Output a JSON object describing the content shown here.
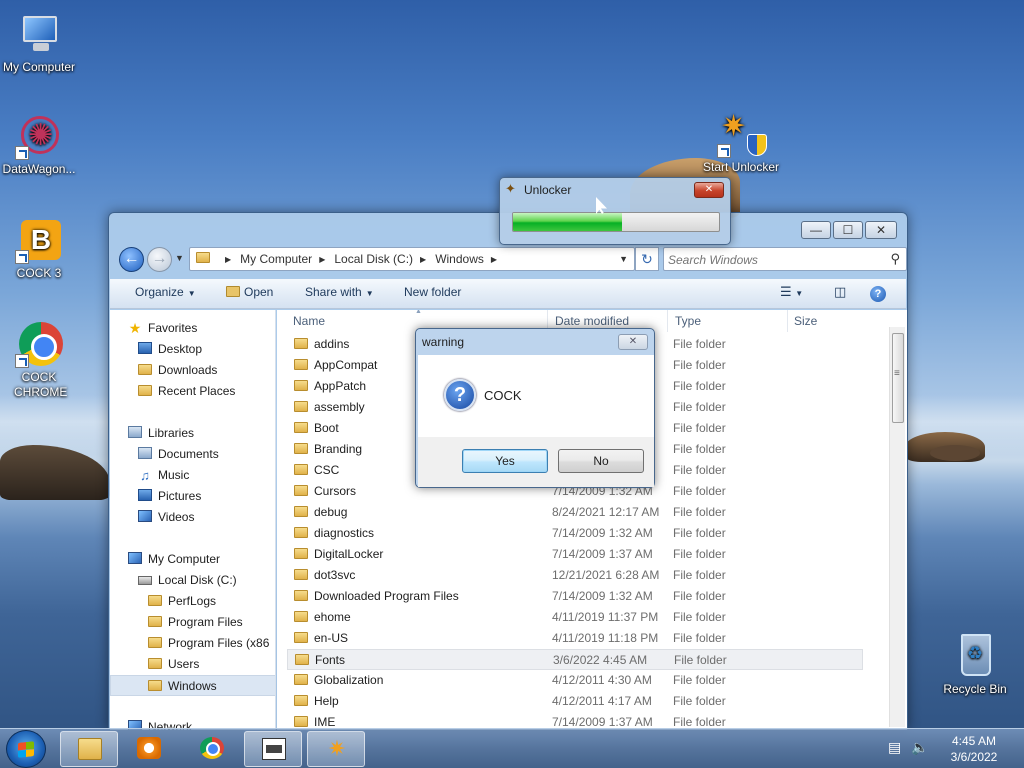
{
  "desktop": {
    "icons": [
      {
        "label": "My Computer",
        "icon": "monitor-icon"
      },
      {
        "label": "DataWagon...",
        "icon": "datawagon-icon"
      },
      {
        "label": "COCK 3",
        "icon": "b-app-icon"
      },
      {
        "label": "COCK CHROME",
        "icon": "chrome-icon"
      },
      {
        "label": "Start Unlocker",
        "icon": "unlocker-icon"
      },
      {
        "label": "Recycle Bin",
        "icon": "recycle-bin-icon"
      }
    ]
  },
  "unlocker": {
    "title": "Unlocker",
    "progress": 0.53
  },
  "explorer": {
    "controls": {
      "minimize": "—",
      "maximize": "☐",
      "close": "✕"
    },
    "breadcrumb": [
      "My Computer",
      "Local Disk (C:)",
      "Windows"
    ],
    "search_placeholder": "Search Windows",
    "toolbar": {
      "organize": "Organize",
      "open": "Open",
      "share_with": "Share with",
      "new_folder": "New folder"
    },
    "nav": {
      "favorites": "Favorites",
      "desktop": "Desktop",
      "downloads": "Downloads",
      "recent_places": "Recent Places",
      "libraries": "Libraries",
      "documents": "Documents",
      "music": "Music",
      "pictures": "Pictures",
      "videos": "Videos",
      "my_computer": "My Computer",
      "local_disk": "Local Disk (C:)",
      "perflogs": "PerfLogs",
      "program_files": "Program Files",
      "program_files_x86": "Program Files (x86",
      "users": "Users",
      "windows": "Windows",
      "network": "Network"
    },
    "columns": {
      "name": "Name",
      "date_modified": "Date modified",
      "type": "Type",
      "size": "Size"
    },
    "files": [
      {
        "name": "addins",
        "date": "",
        "type": "File folder"
      },
      {
        "name": "AppCompat",
        "date": "",
        "type": "File folder"
      },
      {
        "name": "AppPatch",
        "date": "",
        "type": "File folder"
      },
      {
        "name": "assembly",
        "date": "",
        "type": "File folder"
      },
      {
        "name": "Boot",
        "date": "",
        "type": "File folder"
      },
      {
        "name": "Branding",
        "date": "",
        "type": "File folder"
      },
      {
        "name": "CSC",
        "date": "",
        "type": "File folder"
      },
      {
        "name": "Cursors",
        "date": "7/14/2009 1:32 AM",
        "type": "File folder"
      },
      {
        "name": "debug",
        "date": "8/24/2021 12:17 AM",
        "type": "File folder"
      },
      {
        "name": "diagnostics",
        "date": "7/14/2009 1:32 AM",
        "type": "File folder"
      },
      {
        "name": "DigitalLocker",
        "date": "7/14/2009 1:37 AM",
        "type": "File folder"
      },
      {
        "name": "dot3svc",
        "date": "12/21/2021 6:28 AM",
        "type": "File folder"
      },
      {
        "name": "Downloaded Program Files",
        "date": "7/14/2009 1:32 AM",
        "type": "File folder"
      },
      {
        "name": "ehome",
        "date": "4/11/2019 11:37 PM",
        "type": "File folder"
      },
      {
        "name": "en-US",
        "date": "4/11/2019 11:18 PM",
        "type": "File folder"
      },
      {
        "name": "Fonts",
        "date": "3/6/2022 4:45 AM",
        "type": "File folder"
      },
      {
        "name": "Globalization",
        "date": "4/12/2011 4:30 AM",
        "type": "File folder"
      },
      {
        "name": "Help",
        "date": "4/12/2011 4:17 AM",
        "type": "File folder"
      },
      {
        "name": "IME",
        "date": "7/14/2009 1:37 AM",
        "type": "File folder"
      }
    ]
  },
  "dialog": {
    "title": "warning",
    "message": "COCK",
    "yes": "Yes",
    "no": "No",
    "close": "✕"
  },
  "taskbar": {
    "time": "4:45 AM",
    "date": "3/6/2022"
  }
}
